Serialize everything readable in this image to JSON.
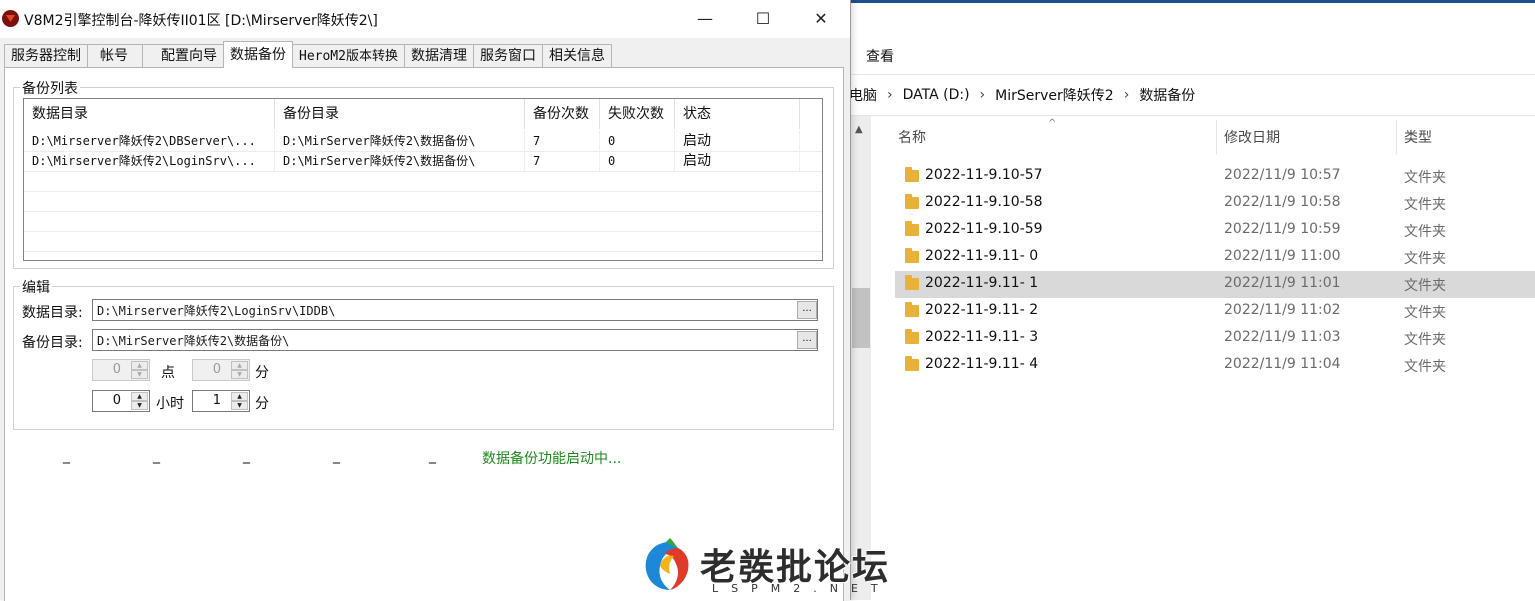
{
  "explorer": {
    "view_tab": "查看",
    "breadcrumb": [
      "电脑",
      "DATA (D:)",
      "MirServer降妖传2",
      "数据备份"
    ],
    "columns": {
      "name": "名称",
      "date": "修改日期",
      "type": "类型"
    },
    "items": [
      {
        "name": "2022-11-9.10-57",
        "date": "2022/11/9 10:57",
        "type": "文件夹"
      },
      {
        "name": "2022-11-9.10-58",
        "date": "2022/11/9 10:58",
        "type": "文件夹"
      },
      {
        "name": "2022-11-9.10-59",
        "date": "2022/11/9 10:59",
        "type": "文件夹"
      },
      {
        "name": "2022-11-9.11- 0",
        "date": "2022/11/9 11:00",
        "type": "文件夹"
      },
      {
        "name": "2022-11-9.11- 1",
        "date": "2022/11/9 11:01",
        "type": "文件夹"
      },
      {
        "name": "2022-11-9.11- 2",
        "date": "2022/11/9 11:02",
        "type": "文件夹"
      },
      {
        "name": "2022-11-9.11- 3",
        "date": "2022/11/9 11:03",
        "type": "文件夹"
      },
      {
        "name": "2022-11-9.11- 4",
        "date": "2022/11/9 11:04",
        "type": "文件夹"
      }
    ],
    "selected_index": 4
  },
  "console": {
    "title": "V8M2引擎控制台-降妖传II01区 [D:\\Mirserver降妖传2\\]",
    "window_buttons": {
      "minimize": "—",
      "maximize": "☐",
      "close": "✕"
    },
    "tabs": [
      "服务器控制",
      "帐号",
      "配置向导",
      "数据备份",
      "HeroM2版本转换",
      "数据清理",
      "服务窗口",
      "相关信息"
    ],
    "active_tab": 3,
    "backup_list": {
      "title": "备份列表",
      "headers": [
        "数据目录",
        "备份目录",
        "备份次数",
        "失败次数",
        "状态"
      ],
      "rows": [
        [
          "D:\\Mirserver降妖传2\\DBServer\\...",
          "D:\\MirServer降妖传2\\数据备份\\",
          "7",
          "0",
          "启动"
        ],
        [
          "D:\\Mirserver降妖传2\\LoginSrv\\...",
          "D:\\MirServer降妖传2\\数据备份\\",
          "7",
          "0",
          "启动"
        ]
      ]
    },
    "edit": {
      "title": "编辑",
      "data_dir_label": "数据目录:",
      "data_dir_value": "D:\\Mirserver降妖传2\\LoginSrv\\IDDB\\",
      "backup_dir_label": "备份目录:",
      "backup_dir_value": "D:\\MirServer降妖传2\\数据备份\\",
      "browse_label": "...",
      "time_hour_value": "0",
      "time_hour_unit": "点",
      "time_minute_value": "0",
      "time_minute_unit": "分",
      "interval_hour_value": "0",
      "interval_hour_unit": "小时",
      "interval_minute_value": "1",
      "interval_minute_unit": "分"
    },
    "dashes": [
      "_",
      "_",
      "_",
      "_",
      "_"
    ],
    "status": "数据备份功能启动中..."
  },
  "watermark": {
    "text": "老彂批论坛",
    "sub": "LSPM2.NET"
  }
}
